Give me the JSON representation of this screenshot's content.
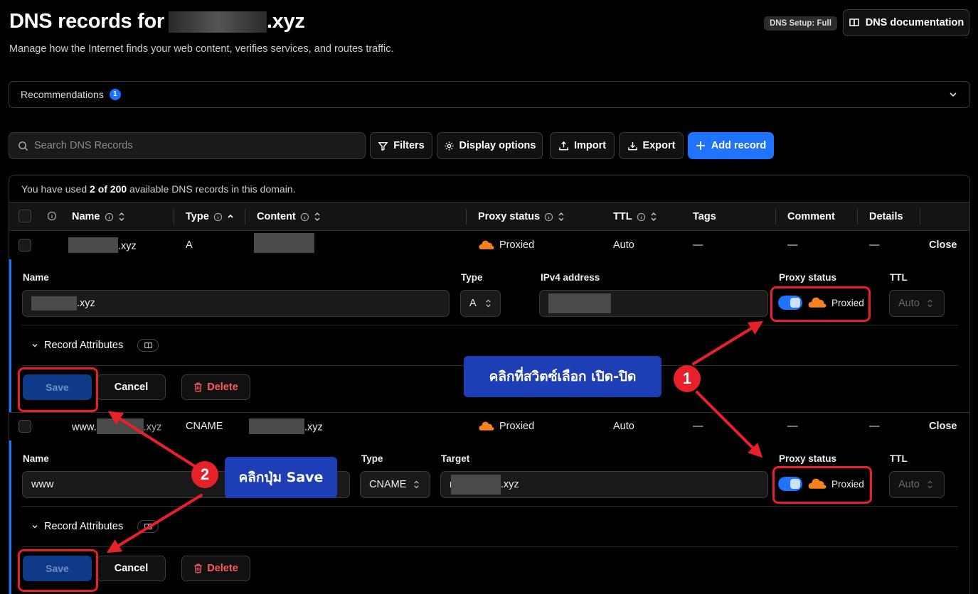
{
  "header": {
    "title_prefix": "DNS records for",
    "title_suffix": ".xyz",
    "subtitle": "Manage how the Internet finds your web content, verifies services, and routes traffic.",
    "setup_badge": "DNS Setup: Full",
    "doc_button": "DNS documentation"
  },
  "recommendations": {
    "label": "Recommendations",
    "count": "1"
  },
  "toolbar": {
    "search_placeholder": "Search DNS Records",
    "filters": "Filters",
    "display_options": "Display options",
    "import": "Import",
    "export": "Export",
    "add_record": "Add record"
  },
  "usage": {
    "prefix": "You have used",
    "count": "2 of 200",
    "suffix": "available DNS records in this domain."
  },
  "columns": {
    "name": "Name",
    "type": "Type",
    "content": "Content",
    "proxy": "Proxy status",
    "ttl": "TTL",
    "tags": "Tags",
    "comment": "Comment",
    "details": "Details"
  },
  "records": [
    {
      "name_suffix": ".xyz",
      "type": "A",
      "content_suffix": "",
      "proxy": "Proxied",
      "ttl": "Auto",
      "tags": "—",
      "comment": "—",
      "details": "—",
      "close": "Close",
      "edit": {
        "name_label": "Name",
        "name_value_suffix": ".xyz",
        "type_label": "Type",
        "type_value": "A",
        "content_label": "IPv4 address",
        "proxy_label": "Proxy status",
        "proxy_value": "Proxied",
        "ttl_label": "TTL",
        "ttl_value": "Auto",
        "attributes": "Record Attributes",
        "save": "Save",
        "cancel": "Cancel",
        "delete": "Delete"
      }
    },
    {
      "name_prefix": "www.",
      "name_suffix": ".xyz",
      "type": "CNAME",
      "content_suffix": ".xyz",
      "proxy": "Proxied",
      "ttl": "Auto",
      "tags": "—",
      "comment": "—",
      "details": "—",
      "close": "Close",
      "edit": {
        "name_label": "Name",
        "name_value": "www",
        "type_label": "Type",
        "type_value": "CNAME",
        "content_label": "Target",
        "content_value_prefix": "r",
        "content_value_suffix": ".xyz",
        "proxy_label": "Proxy status",
        "proxy_value": "Proxied",
        "ttl_label": "TTL",
        "ttl_value": "Auto",
        "attributes": "Record Attributes",
        "save": "Save",
        "cancel": "Cancel",
        "delete": "Delete"
      }
    }
  ],
  "annotations": {
    "step1_text": "คลิกที่สวิตซ์เลือก เปิด-ปิด",
    "step1_num": "1",
    "step2_text": "คลิกปุ่ม Save",
    "step2_num": "2"
  },
  "colors": {
    "accent": "#1f73ff",
    "annotation_red": "#e8202a",
    "callout_blue": "#1e3eb5",
    "cloud_orange": "#f6821f",
    "delete_red": "#ff5a5a"
  }
}
